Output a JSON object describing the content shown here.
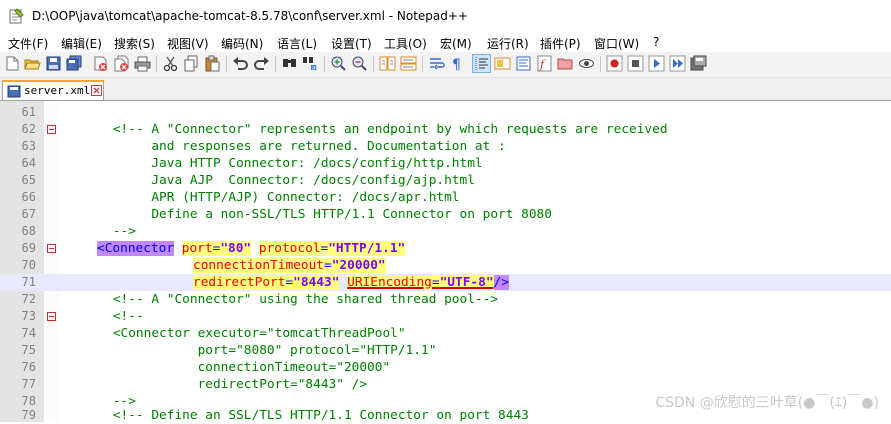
{
  "window": {
    "title": "D:\\OOP\\java\\tomcat\\apache-tomcat-8.5.78\\conf\\server.xml - Notepad++"
  },
  "menu": [
    "文件(F)",
    "编辑(E)",
    "搜索(S)",
    "视图(V)",
    "编码(N)",
    "语言(L)",
    "设置(T)",
    "工具(O)",
    "宏(M)",
    "运行(R)",
    "插件(P)",
    "窗口(W)",
    "?"
  ],
  "toolbar": {
    "icons": [
      "new-file-icon",
      "open-file-icon",
      "save-icon",
      "save-all-icon",
      "close-icon",
      "close-all-icon",
      "print-icon",
      "cut-icon",
      "copy-icon",
      "paste-icon",
      "undo-icon",
      "redo-icon",
      "find-icon",
      "replace-icon",
      "zoom-in-icon",
      "zoom-out-icon",
      "sync-vertical-icon",
      "sync-horizontal-icon",
      "word-wrap-icon",
      "show-all-chars-icon",
      "indent-guide-icon",
      "user-language-icon",
      "doc-map-icon",
      "function-list-icon",
      "folder-workspace-icon",
      "monitor-icon",
      "record-macro-icon",
      "stop-record-icon",
      "play-macro-icon",
      "run-macro-multiple-icon",
      "save-macro-icon"
    ]
  },
  "tab": {
    "label": "server.xml"
  },
  "lines": [
    {
      "n": "61",
      "text": ""
    },
    {
      "n": "62",
      "text": "    <!-- A \"Connector\" represents an endpoint by which requests are received"
    },
    {
      "n": "63",
      "text": "         and responses are returned. Documentation at :"
    },
    {
      "n": "64",
      "text": "         Java HTTP Connector: /docs/config/http.html"
    },
    {
      "n": "65",
      "text": "         Java AJP  Connector: /docs/config/ajp.html"
    },
    {
      "n": "66",
      "text": "         APR (HTTP/AJP) Connector: /docs/apr.html"
    },
    {
      "n": "67",
      "text": "         Define a non-SSL/TLS HTTP/1.1 Connector on port 8080"
    },
    {
      "n": "68",
      "text": "    -->"
    },
    {
      "n": "69",
      "tag_open": "<Connector",
      "attr1": "port",
      "val1": "\"80\"",
      "attr2": "protocol",
      "val2": "\"HTTP/1.1\""
    },
    {
      "n": "70",
      "attr": "connectionTimeout",
      "val": "\"20000\""
    },
    {
      "n": "71",
      "attr1": "redirectPort",
      "val1": "\"8443\"",
      "attr2": "URIEncoding",
      "val2": "\"UTF-8\"",
      "close": "/>"
    },
    {
      "n": "72",
      "text": "    <!-- A \"Connector\" using the shared thread pool-->"
    },
    {
      "n": "73",
      "text": "    <!--"
    },
    {
      "n": "74",
      "text": "    <Connector executor=\"tomcatThreadPool\""
    },
    {
      "n": "75",
      "text": "               port=\"8080\" protocol=\"HTTP/1.1\""
    },
    {
      "n": "76",
      "text": "               connectionTimeout=\"20000\""
    },
    {
      "n": "77",
      "text": "               redirectPort=\"8443\" />"
    },
    {
      "n": "78",
      "text": "    -->"
    },
    {
      "n": "79",
      "text": "    <!-- Define an SSL/TLS HTTP/1.1 Connector on port 8443"
    }
  ],
  "watermark": "CSDN @欣慰的三叶草(●￣(ｴ)￣●)",
  "colors": {
    "comment": "#008000",
    "tag": "#0000ff",
    "attribute": "#ff0000",
    "value": "#8000ff",
    "tab_accent": "#f7a823",
    "current_line": "#e8e8ff"
  }
}
